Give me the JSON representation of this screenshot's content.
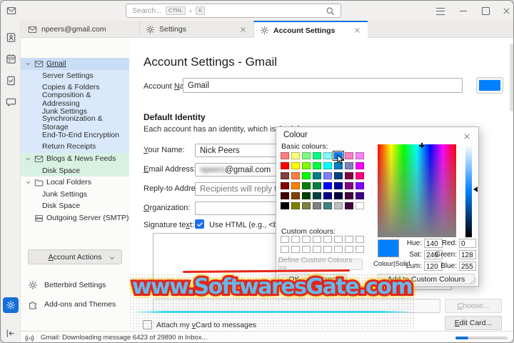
{
  "window": {
    "search": {
      "placeholder": "Search...",
      "kbd": [
        "CTRL",
        "+",
        "K"
      ]
    }
  },
  "tabs": [
    {
      "label": "npeers@gmail.com"
    },
    {
      "label": "Settings"
    },
    {
      "label": "Account Settings"
    }
  ],
  "sidebar": {
    "items": [
      {
        "label": "Gmail",
        "icon": "mail",
        "expander": true,
        "group": "gmail",
        "selected": true
      },
      {
        "label": "Server Settings",
        "child": true,
        "group": "gmail"
      },
      {
        "label": "Copies & Folders",
        "child": true,
        "group": "gmail"
      },
      {
        "label": "Composition & Addressing",
        "child": true,
        "group": "gmail"
      },
      {
        "label": "Junk Settings",
        "child": true,
        "group": "gmail"
      },
      {
        "label": "Synchronization & Storage",
        "child": true,
        "group": "gmail"
      },
      {
        "label": "End-To-End Encryption",
        "child": true,
        "group": "gmail"
      },
      {
        "label": "Return Receipts",
        "child": true,
        "group": "gmail"
      },
      {
        "label": "Blogs & News Feeds",
        "icon": "mail",
        "expander": true,
        "group": "feeds"
      },
      {
        "label": "Disk Space",
        "child": true,
        "group": "feeds"
      },
      {
        "label": "Local Folders",
        "icon": "folder",
        "expander": true,
        "group": "none"
      },
      {
        "label": "Junk Settings",
        "child": true,
        "group": "none"
      },
      {
        "label": "Disk Space",
        "child": true,
        "group": "none"
      },
      {
        "label": "Outgoing Server (SMTP)",
        "icon": "server",
        "expander": false,
        "group": "none"
      }
    ],
    "account_actions": {
      "pre": "",
      "key": "A",
      "post": "ccount Actions"
    },
    "bottom_items": [
      {
        "label": "Betterbird Settings",
        "icon": "gear"
      },
      {
        "label": "Add-ons and Themes",
        "icon": "puzzle"
      }
    ]
  },
  "main": {
    "title": "Account Settings - Gmail",
    "account_name_label": {
      "pre": "Account ",
      "key": "N",
      "post": "ame:"
    },
    "account_name_value": "Gmail",
    "default_identity": {
      "heading": "Default Identity",
      "description": "Each account has an identity, which is the inform"
    },
    "fields": {
      "your_name": {
        "label": {
          "pre": "",
          "key": "Y",
          "post": "our Name:"
        },
        "value": "Nick Peers"
      },
      "email": {
        "label": {
          "pre": "",
          "key": "E",
          "post": "mail Address:"
        },
        "user": "npeers",
        "domain": "@gmail.com"
      },
      "reply_to": {
        "label": {
          "pre": "Reply-to Addres",
          "key": "s",
          "post": ":"
        },
        "placeholder": "Recipients will reply to this "
      },
      "organization": {
        "label": {
          "pre": "",
          "key": "O",
          "post": "rganization:"
        },
        "value": ""
      },
      "signature": {
        "label": {
          "pre": "Signature te",
          "key": "x",
          "post": "t:"
        },
        "use_html_label": "Use HTML (e.g., <b>bold"
      }
    },
    "attach_vcard_label": {
      "pre": "Attach my ",
      "key": "v",
      "post": "Card to messages"
    },
    "choose_button": {
      "pre": "",
      "key": "C",
      "post": "hoose..."
    },
    "edit_card_button": {
      "pre": "",
      "key": "E",
      "post": "dit Card..."
    }
  },
  "color_dialog": {
    "title": "Colour",
    "basic_colours_label": "Basic colours:",
    "basic_colours": [
      "#FF8080",
      "#FFFF80",
      "#80FF80",
      "#00FF80",
      "#80FFFF",
      "#0080FF",
      "#FF80C0",
      "#FF80FF",
      "#FF0000",
      "#FFFF00",
      "#80FF00",
      "#00FF40",
      "#00FFFF",
      "#0080C0",
      "#8080C0",
      "#FF00FF",
      "#804040",
      "#FF8040",
      "#00FF00",
      "#008080",
      "#8080FF",
      "#004080",
      "#800040",
      "#FF0080",
      "#800000",
      "#FF8000",
      "#008000",
      "#008040",
      "#0000FF",
      "#0000A0",
      "#800080",
      "#8000FF",
      "#400000",
      "#804000",
      "#004000",
      "#004040",
      "#000080",
      "#000040",
      "#400040",
      "#400080",
      "#000000",
      "#808000",
      "#808040",
      "#808080",
      "#408080",
      "#C0C0C0",
      "#400040",
      "#FFFFFF"
    ],
    "selected_index": 5,
    "selected_colour": "#0080FF",
    "custom_colours_label": "Custom colours:",
    "custom_colours_count": 16,
    "define_custom_label": "Define Custom Colours >>",
    "colour_solid_label": "Colour|Solid",
    "hue": {
      "label": "Hue:",
      "value": "140"
    },
    "sat": {
      "label": "Sat:",
      "value": "240"
    },
    "lum": {
      "label": "Lum:",
      "value": "120"
    },
    "red": {
      "label": "Red:",
      "value": "0"
    },
    "green": {
      "label": "Green:",
      "value": "128"
    },
    "blue": {
      "label": "Blue:",
      "value": "255"
    },
    "ok_label": "OK",
    "cancel_label": "Cancel",
    "add_custom_label": "Add to Custom Colours"
  },
  "statusbar": {
    "text": "Gmail: Downloading message 6423 of 29890 in Inbox..."
  },
  "watermark": {
    "text": "www.SoftwaresGate.com"
  },
  "colors": {
    "accent_blue": "#1673d2",
    "account_colour": "#0080FF"
  }
}
